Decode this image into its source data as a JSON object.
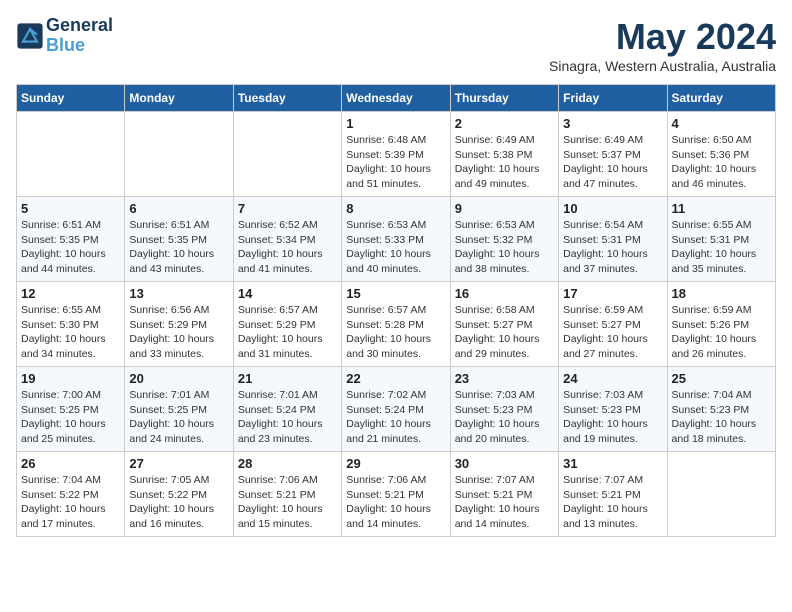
{
  "logo": {
    "line1": "General",
    "line2": "Blue"
  },
  "title": "May 2024",
  "location": "Sinagra, Western Australia, Australia",
  "weekdays": [
    "Sunday",
    "Monday",
    "Tuesday",
    "Wednesday",
    "Thursday",
    "Friday",
    "Saturday"
  ],
  "weeks": [
    [
      {
        "day": "",
        "info": ""
      },
      {
        "day": "",
        "info": ""
      },
      {
        "day": "",
        "info": ""
      },
      {
        "day": "1",
        "info": "Sunrise: 6:48 AM\nSunset: 5:39 PM\nDaylight: 10 hours\nand 51 minutes."
      },
      {
        "day": "2",
        "info": "Sunrise: 6:49 AM\nSunset: 5:38 PM\nDaylight: 10 hours\nand 49 minutes."
      },
      {
        "day": "3",
        "info": "Sunrise: 6:49 AM\nSunset: 5:37 PM\nDaylight: 10 hours\nand 47 minutes."
      },
      {
        "day": "4",
        "info": "Sunrise: 6:50 AM\nSunset: 5:36 PM\nDaylight: 10 hours\nand 46 minutes."
      }
    ],
    [
      {
        "day": "5",
        "info": "Sunrise: 6:51 AM\nSunset: 5:35 PM\nDaylight: 10 hours\nand 44 minutes."
      },
      {
        "day": "6",
        "info": "Sunrise: 6:51 AM\nSunset: 5:35 PM\nDaylight: 10 hours\nand 43 minutes."
      },
      {
        "day": "7",
        "info": "Sunrise: 6:52 AM\nSunset: 5:34 PM\nDaylight: 10 hours\nand 41 minutes."
      },
      {
        "day": "8",
        "info": "Sunrise: 6:53 AM\nSunset: 5:33 PM\nDaylight: 10 hours\nand 40 minutes."
      },
      {
        "day": "9",
        "info": "Sunrise: 6:53 AM\nSunset: 5:32 PM\nDaylight: 10 hours\nand 38 minutes."
      },
      {
        "day": "10",
        "info": "Sunrise: 6:54 AM\nSunset: 5:31 PM\nDaylight: 10 hours\nand 37 minutes."
      },
      {
        "day": "11",
        "info": "Sunrise: 6:55 AM\nSunset: 5:31 PM\nDaylight: 10 hours\nand 35 minutes."
      }
    ],
    [
      {
        "day": "12",
        "info": "Sunrise: 6:55 AM\nSunset: 5:30 PM\nDaylight: 10 hours\nand 34 minutes."
      },
      {
        "day": "13",
        "info": "Sunrise: 6:56 AM\nSunset: 5:29 PM\nDaylight: 10 hours\nand 33 minutes."
      },
      {
        "day": "14",
        "info": "Sunrise: 6:57 AM\nSunset: 5:29 PM\nDaylight: 10 hours\nand 31 minutes."
      },
      {
        "day": "15",
        "info": "Sunrise: 6:57 AM\nSunset: 5:28 PM\nDaylight: 10 hours\nand 30 minutes."
      },
      {
        "day": "16",
        "info": "Sunrise: 6:58 AM\nSunset: 5:27 PM\nDaylight: 10 hours\nand 29 minutes."
      },
      {
        "day": "17",
        "info": "Sunrise: 6:59 AM\nSunset: 5:27 PM\nDaylight: 10 hours\nand 27 minutes."
      },
      {
        "day": "18",
        "info": "Sunrise: 6:59 AM\nSunset: 5:26 PM\nDaylight: 10 hours\nand 26 minutes."
      }
    ],
    [
      {
        "day": "19",
        "info": "Sunrise: 7:00 AM\nSunset: 5:25 PM\nDaylight: 10 hours\nand 25 minutes."
      },
      {
        "day": "20",
        "info": "Sunrise: 7:01 AM\nSunset: 5:25 PM\nDaylight: 10 hours\nand 24 minutes."
      },
      {
        "day": "21",
        "info": "Sunrise: 7:01 AM\nSunset: 5:24 PM\nDaylight: 10 hours\nand 23 minutes."
      },
      {
        "day": "22",
        "info": "Sunrise: 7:02 AM\nSunset: 5:24 PM\nDaylight: 10 hours\nand 21 minutes."
      },
      {
        "day": "23",
        "info": "Sunrise: 7:03 AM\nSunset: 5:23 PM\nDaylight: 10 hours\nand 20 minutes."
      },
      {
        "day": "24",
        "info": "Sunrise: 7:03 AM\nSunset: 5:23 PM\nDaylight: 10 hours\nand 19 minutes."
      },
      {
        "day": "25",
        "info": "Sunrise: 7:04 AM\nSunset: 5:23 PM\nDaylight: 10 hours\nand 18 minutes."
      }
    ],
    [
      {
        "day": "26",
        "info": "Sunrise: 7:04 AM\nSunset: 5:22 PM\nDaylight: 10 hours\nand 17 minutes."
      },
      {
        "day": "27",
        "info": "Sunrise: 7:05 AM\nSunset: 5:22 PM\nDaylight: 10 hours\nand 16 minutes."
      },
      {
        "day": "28",
        "info": "Sunrise: 7:06 AM\nSunset: 5:21 PM\nDaylight: 10 hours\nand 15 minutes."
      },
      {
        "day": "29",
        "info": "Sunrise: 7:06 AM\nSunset: 5:21 PM\nDaylight: 10 hours\nand 14 minutes."
      },
      {
        "day": "30",
        "info": "Sunrise: 7:07 AM\nSunset: 5:21 PM\nDaylight: 10 hours\nand 14 minutes."
      },
      {
        "day": "31",
        "info": "Sunrise: 7:07 AM\nSunset: 5:21 PM\nDaylight: 10 hours\nand 13 minutes."
      },
      {
        "day": "",
        "info": ""
      }
    ]
  ]
}
